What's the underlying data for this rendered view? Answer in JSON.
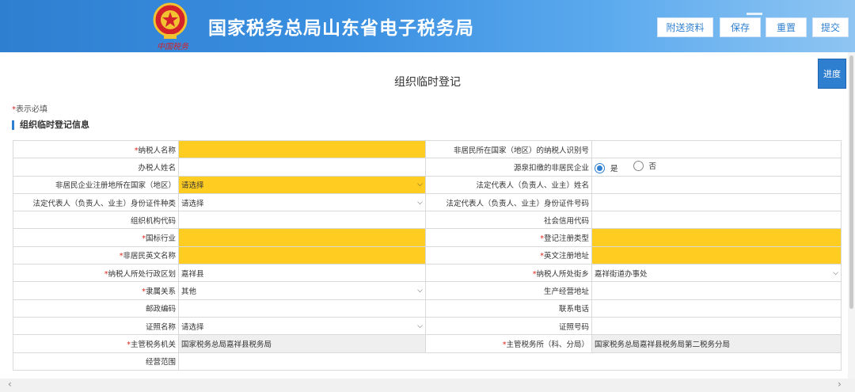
{
  "header": {
    "title": "国家税务总局山东省电子税务局",
    "calligraphy": "中国税务",
    "buttons": [
      "附送资料",
      "保存",
      "重置",
      "提交"
    ]
  },
  "page_title": "组织临时登记",
  "progress_label": "进度",
  "required_note": "表示必填",
  "required_star": "*",
  "section_title": "组织临时登记信息",
  "form": {
    "r1": {
      "l1": "纳税人名称",
      "l2": "非居民所在国家（地区）的纳税人识别号"
    },
    "r2": {
      "l1": "办税人姓名",
      "l2": "源泉扣缴的非居民企业",
      "yes": "是",
      "no": "否"
    },
    "r3": {
      "l1": "非居民企业注册地所在国家（地区）",
      "v1": "请选择",
      "l2": "法定代表人（负责人、业主）姓名"
    },
    "r4": {
      "l1": "法定代表人（负责人、业主）身份证件种类",
      "v1": "请选择",
      "l2": "法定代表人（负责人、业主）身份证件号码"
    },
    "r5": {
      "l1": "组织机构代码",
      "l2": "社会信用代码"
    },
    "r6": {
      "l1": "国标行业",
      "l2": "登记注册类型"
    },
    "r7": {
      "l1": "非居民英文名称",
      "l2": "英文注册地址"
    },
    "r8": {
      "l1": "纳税人所处行政区划",
      "v1": "嘉祥县",
      "l2": "纳税人所处街乡",
      "v2": "嘉祥街道办事处"
    },
    "r9": {
      "l1": "隶属关系",
      "v1": "其他",
      "l2": "生产经营地址"
    },
    "r10": {
      "l1": "邮政编码",
      "l2": "联系电话"
    },
    "r11": {
      "l1": "证照名称",
      "v1": "请选择",
      "l2": "证照号码"
    },
    "r12": {
      "l1": "主管税务机关",
      "v1": "国家税务总局嘉祥县税务局",
      "l2": "主管税务所（科、分局）",
      "v2": "国家税务总局嘉祥县税务局第二税务分局"
    },
    "r13": {
      "l1": "经营范围"
    }
  },
  "colors": {
    "accent": "#2f7fd1",
    "required_fill": "#ffcd21",
    "readonly_fill": "#efefef"
  }
}
